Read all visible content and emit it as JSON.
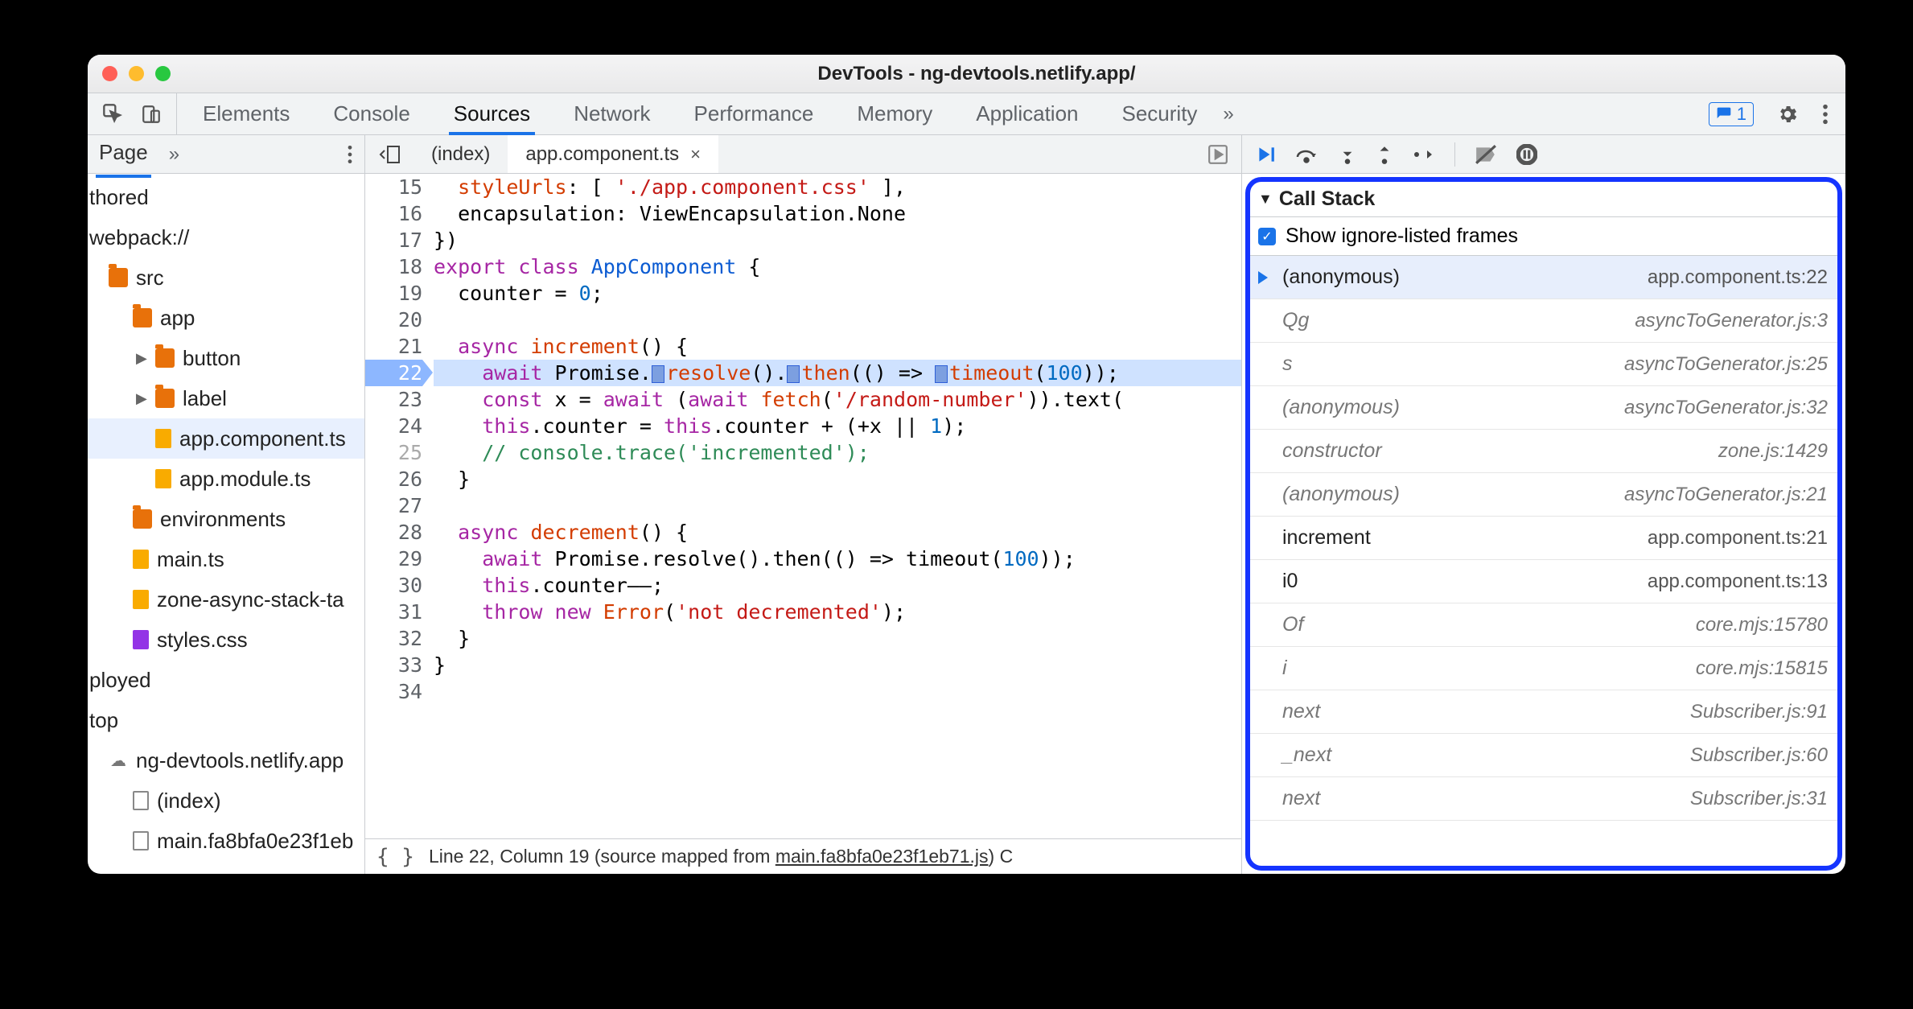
{
  "window": {
    "title": "DevTools - ng-devtools.netlify.app/"
  },
  "tabs": {
    "items": [
      "Elements",
      "Console",
      "Sources",
      "Network",
      "Performance",
      "Memory",
      "Application",
      "Security"
    ],
    "badge_count": "1"
  },
  "navigator": {
    "page_label": "Page",
    "tree": [
      {
        "label": "thored",
        "ind": 0,
        "kind": "text"
      },
      {
        "label": "webpack://",
        "ind": 0,
        "kind": "text"
      },
      {
        "label": "src",
        "ind": 1,
        "kind": "folder-o"
      },
      {
        "label": "app",
        "ind": 2,
        "kind": "folder-o"
      },
      {
        "label": "button",
        "ind": 3,
        "kind": "folder-o",
        "arrow": true
      },
      {
        "label": "label",
        "ind": 3,
        "kind": "folder-o",
        "arrow": true
      },
      {
        "label": "app.component.ts",
        "ind": 3,
        "kind": "file-y",
        "selected": true
      },
      {
        "label": "app.module.ts",
        "ind": 3,
        "kind": "file-y"
      },
      {
        "label": "environments",
        "ind": 2,
        "kind": "folder-o"
      },
      {
        "label": "main.ts",
        "ind": 2,
        "kind": "file-y"
      },
      {
        "label": "zone-async-stack-ta",
        "ind": 2,
        "kind": "file-y"
      },
      {
        "label": "styles.css",
        "ind": 2,
        "kind": "file-p"
      },
      {
        "label": "ployed",
        "ind": 0,
        "kind": "text"
      },
      {
        "label": "top",
        "ind": 0,
        "kind": "text"
      },
      {
        "label": "ng-devtools.netlify.app",
        "ind": 1,
        "kind": "cloud"
      },
      {
        "label": "(index)",
        "ind": 2,
        "kind": "page"
      },
      {
        "label": "main.fa8bfa0e23f1eb",
        "ind": 2,
        "kind": "page"
      }
    ]
  },
  "editor": {
    "open_tabs": [
      {
        "label": "(index)",
        "active": false
      },
      {
        "label": "app.component.ts",
        "active": true,
        "closeable": true
      }
    ],
    "first_line_no": 15,
    "active_line": 22,
    "breakpoint_line": 25,
    "footer": {
      "prefix": "Line 22, Column 19  (source mapped from ",
      "link": "main.fa8bfa0e23f1eb71.js",
      "suffix": ")  C"
    }
  },
  "debugger": {
    "call_stack_header": "Call Stack",
    "show_ignore_label": "Show ignore-listed frames",
    "frames": [
      {
        "fn": "(anonymous)",
        "loc": "app.component.ts:22",
        "current": true
      },
      {
        "fn": "Qg",
        "loc": "asyncToGenerator.js:3",
        "ignored": true
      },
      {
        "fn": "s",
        "loc": "asyncToGenerator.js:25",
        "ignored": true
      },
      {
        "fn": "(anonymous)",
        "loc": "asyncToGenerator.js:32",
        "ignored": true
      },
      {
        "fn": "constructor",
        "loc": "zone.js:1429",
        "ignored": true
      },
      {
        "fn": "(anonymous)",
        "loc": "asyncToGenerator.js:21",
        "ignored": true
      },
      {
        "fn": "increment",
        "loc": "app.component.ts:21"
      },
      {
        "fn": "i0",
        "loc": "app.component.ts:13"
      },
      {
        "fn": "Of",
        "loc": "core.mjs:15780",
        "ignored": true
      },
      {
        "fn": "i",
        "loc": "core.mjs:15815",
        "ignored": true
      },
      {
        "fn": "next",
        "loc": "Subscriber.js:91",
        "ignored": true
      },
      {
        "fn": "_next",
        "loc": "Subscriber.js:60",
        "ignored": true
      },
      {
        "fn": "next",
        "loc": "Subscriber.js:31",
        "ignored": true
      }
    ]
  }
}
